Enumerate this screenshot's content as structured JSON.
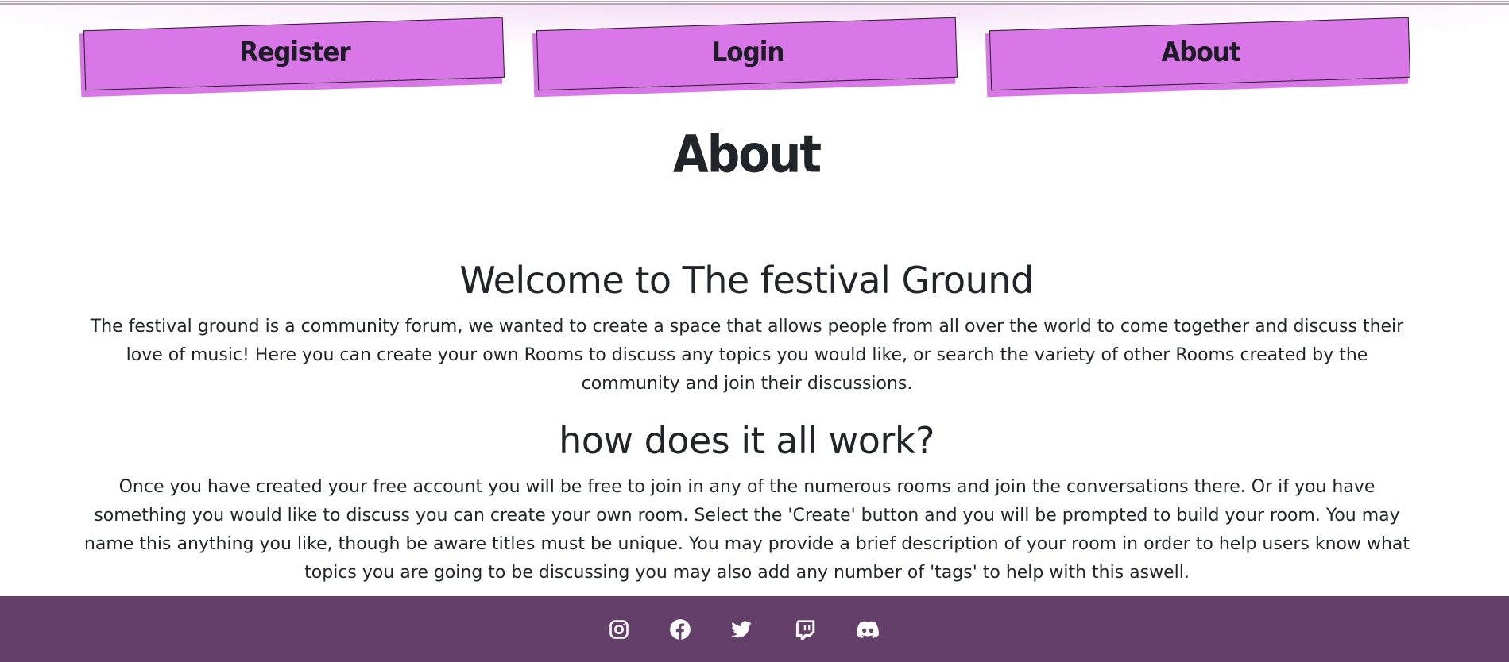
{
  "nav": {
    "items": [
      {
        "label": "Register"
      },
      {
        "label": "Login"
      },
      {
        "label": "About"
      }
    ],
    "button_color": "#d976e8"
  },
  "page": {
    "title": "About"
  },
  "sections": [
    {
      "heading": "Welcome to The festival Ground",
      "text": "The festival ground is a community forum, we wanted to create a space that allows people from all over the world to come together and discuss their love of music! Here you can create your own Rooms to discuss any topics you would like, or search the variety of other Rooms created by the community and join their discussions."
    },
    {
      "heading": "how does it all work?",
      "text": "Once you have created your free account you will be free to join in any of the numerous rooms and join the conversations there. Or if you have something you would like to discuss you can create your own room. Select the 'Create' button and you will be prompted to build your room. You may name this anything you like, though be aware titles must be unique. You may provide a brief description of your room in order to help users know what topics you are going to be discussing you may also add any number of 'tags' to help with this aswell."
    }
  ],
  "footer": {
    "background": "#643f6a",
    "icons": [
      "instagram-icon",
      "facebook-icon",
      "twitter-icon",
      "twitch-icon",
      "discord-icon"
    ]
  }
}
